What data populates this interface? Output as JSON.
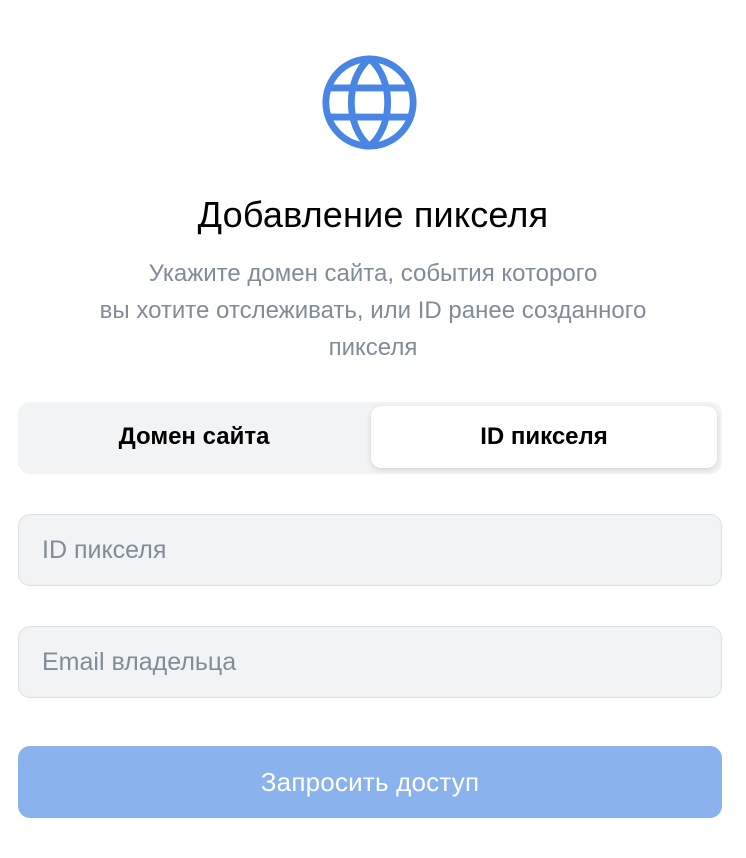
{
  "header": {
    "icon": "globe-icon",
    "title": "Добавление пикселя",
    "subtitle_lines": [
      "Укажите домен сайта, события которого",
      "вы хотите отслеживать, или ID ранее созданного",
      "пикселя"
    ]
  },
  "segmented": {
    "tabs": [
      {
        "label": "Домен сайта",
        "selected": false
      },
      {
        "label": "ID пикселя",
        "selected": true
      }
    ]
  },
  "form": {
    "pixel_id": {
      "value": "",
      "placeholder": "ID пикселя"
    },
    "owner_email": {
      "value": "",
      "placeholder": "Email владельца"
    }
  },
  "submit": {
    "label": "Запросить доступ",
    "enabled": false
  },
  "colors": {
    "accent": "#4986e4",
    "button_disabled": "#8ab3ee",
    "muted_text": "#818c99",
    "field_bg": "#f2f3f5"
  }
}
